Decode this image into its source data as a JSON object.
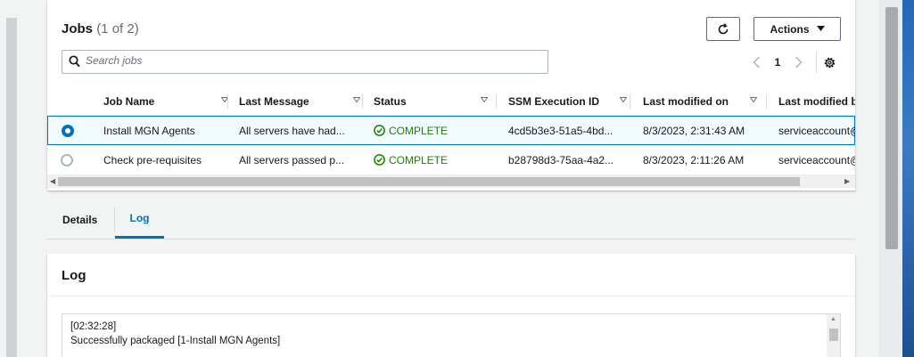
{
  "jobs": {
    "title": "Jobs",
    "count": "(1 of 2)",
    "refresh_icon": "refresh-icon",
    "actions_label": "Actions",
    "search_placeholder": "Search jobs",
    "page": "1",
    "columns": [
      "Job Name",
      "Last Message",
      "Status",
      "SSM Execution ID",
      "Last modified on",
      "Last modified b"
    ],
    "rows": [
      {
        "selected": true,
        "name": "Install MGN Agents",
        "message": "All servers have had...",
        "status": "COMPLETE",
        "ssm_id": "4cd5b3e3-51a5-4bd...",
        "modified_on": "8/3/2023, 2:31:43 AM",
        "modified_by": "serviceaccount@"
      },
      {
        "selected": false,
        "name": "Check pre-requisites",
        "message": "All servers passed p...",
        "status": "COMPLETE",
        "ssm_id": "b28798d3-75aa-4a2...",
        "modified_on": "8/3/2023, 2:11:26 AM",
        "modified_by": "serviceaccount@"
      }
    ]
  },
  "tabs": {
    "details": "Details",
    "log": "Log"
  },
  "log": {
    "title": "Log",
    "lines": [
      "[02:32:28]",
      "Successfully packaged [1-Install MGN Agents]"
    ]
  },
  "colors": {
    "accent": "#0073bb",
    "success": "#1d8102",
    "selected_row_bg": "#f1faff"
  }
}
